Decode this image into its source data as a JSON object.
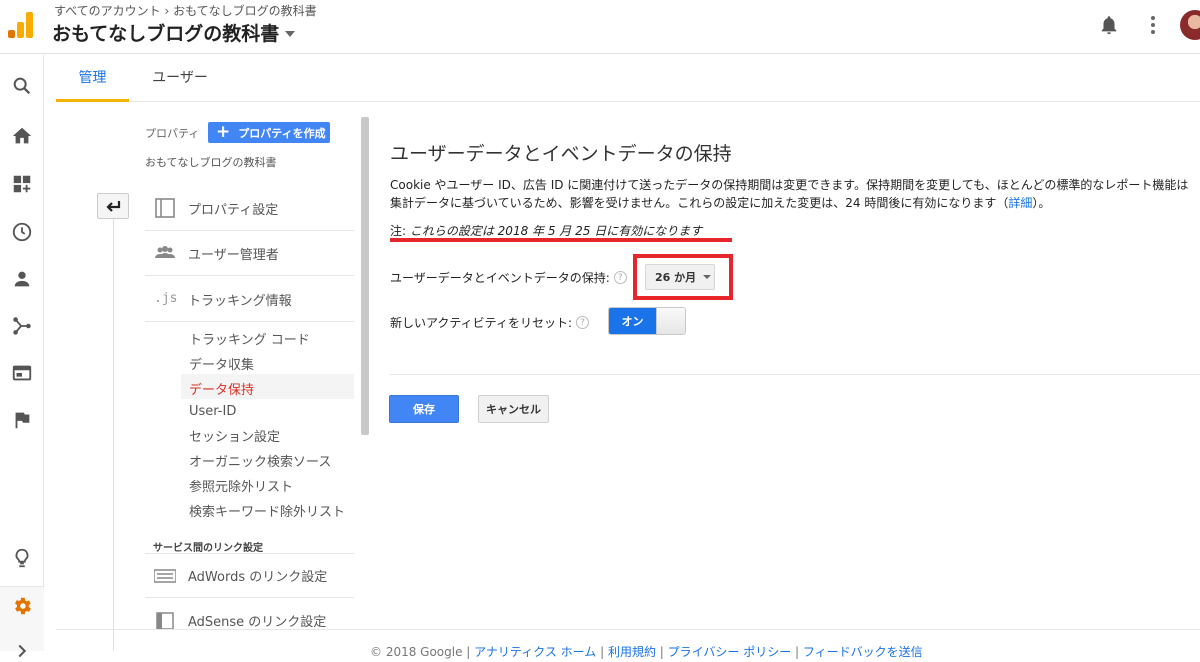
{
  "header": {
    "breadcrumb": "すべてのアカウント › おもてなしブログの教科書",
    "account_name": "おもてなしブログの教科書"
  },
  "tabs": [
    {
      "label": "管理",
      "active": true
    },
    {
      "label": "ユーザー",
      "active": false
    }
  ],
  "property": {
    "label": "プロパティ",
    "create_button": "プロパティを作成",
    "name": "おもてなしブログの教科書"
  },
  "menu": {
    "items": [
      {
        "label": "プロパティ設定",
        "icon": "property-settings-icon"
      },
      {
        "label": "ユーザー管理者",
        "icon": "users-icon"
      },
      {
        "label": "トラッキング情報",
        "icon": "js-icon"
      }
    ],
    "tracking_sub": [
      {
        "label": "トラッキング コード",
        "active": false
      },
      {
        "label": "データ収集",
        "active": false
      },
      {
        "label": "データ保持",
        "active": true
      },
      {
        "label": "User-ID",
        "active": false
      },
      {
        "label": "セッション設定",
        "active": false
      },
      {
        "label": "オーガニック検索ソース",
        "active": false
      },
      {
        "label": "参照元除外リスト",
        "active": false
      },
      {
        "label": "検索キーワード除外リスト",
        "active": false
      }
    ],
    "link_section_title": "サービス間のリンク設定",
    "link_items": [
      {
        "label": "AdWords のリンク設定",
        "icon": "adwords-icon"
      },
      {
        "label": "AdSense のリンク設定",
        "icon": "adsense-icon"
      }
    ]
  },
  "main": {
    "title": "ユーザーデータとイベントデータの保持",
    "description": "Cookie やユーザー ID、広告 ID に関連付けて送ったデータの保持期間は変更できます。保持期間を変更しても、ほとんどの標準的なレポート機能は集計データに基づいているため、影響を受けません。これらの設定に加えた変更は、24 時間後に有効になります（",
    "description_link": "詳細",
    "description_end": "）。",
    "note_prefix": "注: ",
    "note_text": "これらの設定は 2018 年 5 月 25 日に有効になります",
    "retention_label": "ユーザーデータとイベントデータの保持:",
    "retention_value": "26 か月",
    "reset_label": "新しいアクティビティをリセット:",
    "toggle_label": "オン",
    "help": "?",
    "save_button": "保存",
    "cancel_button": "キャンセル"
  },
  "footer": {
    "copyright": "© 2018 Google",
    "links": [
      "アナリティクス ホーム",
      "利用規約",
      "プライバシー ポリシー",
      "フィードバックを送信"
    ]
  },
  "colors": {
    "accent_blue": "#4285f4",
    "highlight_red": "#e8252b",
    "active_red_text": "#d93025",
    "tab_underline": "#f4b400",
    "settings_orange": "#e37400"
  }
}
